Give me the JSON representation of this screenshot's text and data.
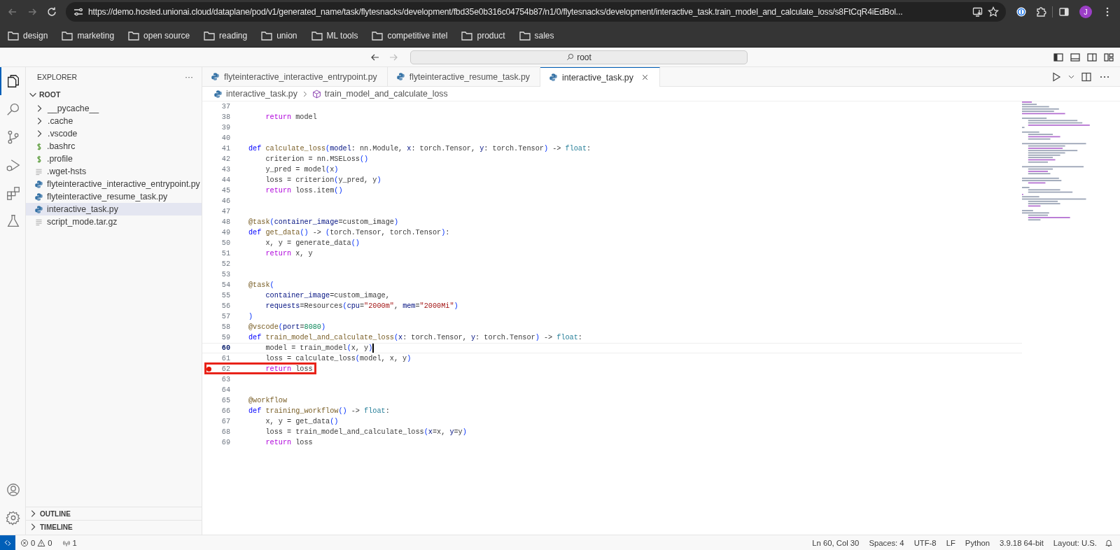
{
  "browser": {
    "url": "https://demo.hosted.unionai.cloud/dataplane/pod/v1/generated_name/task/flytesnacks/development/fbd35e0b316c04754b87/n1/0/flytesnacks/development/interactive_task.train_model_and_calculate_loss/s8FtCqR4iEdBol...",
    "profile_initial": "J",
    "bookmarks": [
      "design",
      "marketing",
      "open source",
      "reading",
      "union",
      "ML tools",
      "competitive intel",
      "product",
      "sales"
    ]
  },
  "title_bar": {
    "search": "root"
  },
  "activity_bar": [
    {
      "selected": true
    },
    {
      "selected": false
    },
    {
      "selected": false
    },
    {
      "selected": false
    },
    {
      "selected": false
    },
    {
      "selected": false
    }
  ],
  "explorer": {
    "title": "EXPLORER",
    "more": "···",
    "root": {
      "label": "ROOT",
      "expanded": true
    },
    "items": [
      {
        "label": "__pycache__",
        "kind": "folder",
        "expanded": false,
        "selected": false
      },
      {
        "label": ".cache",
        "kind": "folder",
        "expanded": false,
        "selected": false
      },
      {
        "label": ".vscode",
        "kind": "folder",
        "expanded": false,
        "selected": false
      },
      {
        "label": ".bashrc",
        "kind": "shell",
        "selected": false
      },
      {
        "label": ".profile",
        "kind": "shell",
        "selected": false
      },
      {
        "label": ".wget-hsts",
        "kind": "text",
        "selected": false
      },
      {
        "label": "flyteinteractive_interactive_entrypoint.py",
        "kind": "python",
        "selected": false
      },
      {
        "label": "flyteinteractive_resume_task.py",
        "kind": "python",
        "selected": false
      },
      {
        "label": "interactive_task.py",
        "kind": "python",
        "selected": true
      },
      {
        "label": "script_mode.tar.gz",
        "kind": "text",
        "selected": false
      }
    ],
    "sections": [
      {
        "label": "OUTLINE",
        "expanded": false
      },
      {
        "label": "TIMELINE",
        "expanded": false
      }
    ]
  },
  "tabs": [
    {
      "label": "flyteinteractive_interactive_entrypoint.py",
      "selected": false
    },
    {
      "label": "flyteinteractive_resume_task.py",
      "selected": false
    },
    {
      "label": "interactive_task.py",
      "selected": true
    }
  ],
  "breadcrumb": {
    "file": "interactive_task.py",
    "symbol": "train_model_and_calculate_loss"
  },
  "lines": [
    {
      "no": "37",
      "breakpoint": false,
      "current": false,
      "highlighted": false
    },
    {
      "no": "38",
      "breakpoint": false,
      "current": false,
      "highlighted": false,
      "tokens": [
        {
          "text": "    return",
          "kind": "control"
        },
        {
          "text": " model",
          "kind": "plain"
        }
      ]
    },
    {
      "no": "39",
      "breakpoint": false,
      "current": false,
      "highlighted": false
    },
    {
      "no": "40",
      "breakpoint": false,
      "current": false,
      "highlighted": false
    },
    {
      "no": "41",
      "breakpoint": false,
      "current": false,
      "highlighted": false,
      "tokens": [
        {
          "text": "def ",
          "kind": "keyword"
        },
        {
          "text": "calculate_loss",
          "kind": "function"
        },
        {
          "text": "(",
          "kind": "bracket"
        },
        {
          "text": "model",
          "kind": "variable"
        },
        {
          "text": ": nn.Module, ",
          "kind": "plain"
        },
        {
          "text": "x",
          "kind": "variable"
        },
        {
          "text": ": torch.Tensor, ",
          "kind": "plain"
        },
        {
          "text": "y",
          "kind": "variable"
        },
        {
          "text": ": torch.Tensor",
          "kind": "plain"
        },
        {
          "text": ")",
          "kind": "bracket"
        },
        {
          "text": " -> ",
          "kind": "plain"
        },
        {
          "text": "float",
          "kind": "type"
        },
        {
          "text": ":",
          "kind": "plain"
        }
      ]
    },
    {
      "no": "42",
      "breakpoint": false,
      "current": false,
      "highlighted": false,
      "tokens": [
        {
          "text": "    criterion = nn.MSELoss",
          "kind": "plain"
        },
        {
          "text": "()",
          "kind": "bracket"
        }
      ]
    },
    {
      "no": "43",
      "breakpoint": false,
      "current": false,
      "highlighted": false,
      "tokens": [
        {
          "text": "    y_pred = model",
          "kind": "plain"
        },
        {
          "text": "(",
          "kind": "bracket"
        },
        {
          "text": "x",
          "kind": "plain"
        },
        {
          "text": ")",
          "kind": "bracket"
        }
      ]
    },
    {
      "no": "44",
      "breakpoint": false,
      "current": false,
      "highlighted": false,
      "tokens": [
        {
          "text": "    loss = criterion",
          "kind": "plain"
        },
        {
          "text": "(",
          "kind": "bracket"
        },
        {
          "text": "y_pred, y",
          "kind": "plain"
        },
        {
          "text": ")",
          "kind": "bracket"
        }
      ]
    },
    {
      "no": "45",
      "breakpoint": false,
      "current": false,
      "highlighted": false,
      "tokens": [
        {
          "text": "    return",
          "kind": "control"
        },
        {
          "text": " loss.item",
          "kind": "plain"
        },
        {
          "text": "()",
          "kind": "bracket"
        }
      ]
    },
    {
      "no": "46",
      "breakpoint": false,
      "current": false,
      "highlighted": false
    },
    {
      "no": "47",
      "breakpoint": false,
      "current": false,
      "highlighted": false
    },
    {
      "no": "48",
      "breakpoint": false,
      "current": false,
      "highlighted": false,
      "tokens": [
        {
          "text": "@task",
          "kind": "function"
        },
        {
          "text": "(",
          "kind": "bracket"
        },
        {
          "text": "container_image",
          "kind": "variable"
        },
        {
          "text": "=custom_image",
          "kind": "plain"
        },
        {
          "text": ")",
          "kind": "bracket"
        }
      ]
    },
    {
      "no": "49",
      "breakpoint": false,
      "current": false,
      "highlighted": false,
      "tokens": [
        {
          "text": "def ",
          "kind": "keyword"
        },
        {
          "text": "get_data",
          "kind": "function"
        },
        {
          "text": "()",
          "kind": "bracket"
        },
        {
          "text": " -> ",
          "kind": "plain"
        },
        {
          "text": "(",
          "kind": "bracket"
        },
        {
          "text": "torch.Tensor, torch.Tensor",
          "kind": "plain"
        },
        {
          "text": ")",
          "kind": "bracket"
        },
        {
          "text": ":",
          "kind": "plain"
        }
      ]
    },
    {
      "no": "50",
      "breakpoint": false,
      "current": false,
      "highlighted": false,
      "tokens": [
        {
          "text": "    x, y = generate_data",
          "kind": "plain"
        },
        {
          "text": "()",
          "kind": "bracket"
        }
      ]
    },
    {
      "no": "51",
      "breakpoint": false,
      "current": false,
      "highlighted": false,
      "tokens": [
        {
          "text": "    return",
          "kind": "control"
        },
        {
          "text": " x, y",
          "kind": "plain"
        }
      ]
    },
    {
      "no": "52",
      "breakpoint": false,
      "current": false,
      "highlighted": false
    },
    {
      "no": "53",
      "breakpoint": false,
      "current": false,
      "highlighted": false
    },
    {
      "no": "54",
      "breakpoint": false,
      "current": false,
      "highlighted": false,
      "tokens": [
        {
          "text": "@task",
          "kind": "function"
        },
        {
          "text": "(",
          "kind": "bracket"
        }
      ]
    },
    {
      "no": "55",
      "breakpoint": false,
      "current": false,
      "highlighted": false,
      "tokens": [
        {
          "text": "    container_image",
          "kind": "variable"
        },
        {
          "text": "=custom_image,",
          "kind": "plain"
        }
      ]
    },
    {
      "no": "56",
      "breakpoint": false,
      "current": false,
      "highlighted": false,
      "tokens": [
        {
          "text": "    requests",
          "kind": "variable"
        },
        {
          "text": "=Resources",
          "kind": "plain"
        },
        {
          "text": "(",
          "kind": "bracket"
        },
        {
          "text": "cpu",
          "kind": "variable"
        },
        {
          "text": "=",
          "kind": "plain"
        },
        {
          "text": "\"2000m\"",
          "kind": "string"
        },
        {
          "text": ", ",
          "kind": "plain"
        },
        {
          "text": "mem",
          "kind": "variable"
        },
        {
          "text": "=",
          "kind": "plain"
        },
        {
          "text": "\"2000Mi\"",
          "kind": "string"
        },
        {
          "text": ")",
          "kind": "bracket"
        }
      ]
    },
    {
      "no": "57",
      "breakpoint": false,
      "current": false,
      "highlighted": false,
      "tokens": [
        {
          "text": ")",
          "kind": "bracket"
        }
      ]
    },
    {
      "no": "58",
      "breakpoint": false,
      "current": false,
      "highlighted": false,
      "tokens": [
        {
          "text": "@vscode",
          "kind": "function"
        },
        {
          "text": "(",
          "kind": "bracket"
        },
        {
          "text": "port",
          "kind": "variable"
        },
        {
          "text": "=",
          "kind": "plain"
        },
        {
          "text": "8080",
          "kind": "number"
        },
        {
          "text": ")",
          "kind": "bracket"
        }
      ]
    },
    {
      "no": "59",
      "breakpoint": false,
      "current": false,
      "highlighted": false,
      "tokens": [
        {
          "text": "def ",
          "kind": "keyword"
        },
        {
          "text": "train_model_and_calculate_loss",
          "kind": "function"
        },
        {
          "text": "(",
          "kind": "bracket"
        },
        {
          "text": "x",
          "kind": "variable"
        },
        {
          "text": ": torch.Tensor, ",
          "kind": "plain"
        },
        {
          "text": "y",
          "kind": "variable"
        },
        {
          "text": ": torch.Tensor",
          "kind": "plain"
        },
        {
          "text": ")",
          "kind": "bracket"
        },
        {
          "text": " -> ",
          "kind": "plain"
        },
        {
          "text": "float",
          "kind": "type"
        },
        {
          "text": ":",
          "kind": "plain"
        }
      ]
    },
    {
      "no": "60",
      "breakpoint": false,
      "current": true,
      "highlighted": false,
      "tokens": [
        {
          "text": "    model = train_model",
          "kind": "plain"
        },
        {
          "text": "(",
          "kind": "bracket"
        },
        {
          "text": "x, y",
          "kind": "plain"
        },
        {
          "text": ")",
          "kind": "bracket"
        }
      ]
    },
    {
      "no": "61",
      "breakpoint": false,
      "current": false,
      "highlighted": false,
      "tokens": [
        {
          "text": "    loss = calculate_loss",
          "kind": "plain"
        },
        {
          "text": "(",
          "kind": "bracket"
        },
        {
          "text": "model, x, y",
          "kind": "plain"
        },
        {
          "text": ")",
          "kind": "bracket"
        }
      ]
    },
    {
      "no": "62",
      "breakpoint": true,
      "current": false,
      "highlighted": true,
      "tokens": [
        {
          "text": "    return",
          "kind": "control"
        },
        {
          "text": " loss",
          "kind": "plain"
        }
      ]
    },
    {
      "no": "63",
      "breakpoint": false,
      "current": false,
      "highlighted": false
    },
    {
      "no": "64",
      "breakpoint": false,
      "current": false,
      "highlighted": false
    },
    {
      "no": "65",
      "breakpoint": false,
      "current": false,
      "highlighted": false,
      "tokens": [
        {
          "text": "@workflow",
          "kind": "function"
        }
      ]
    },
    {
      "no": "66",
      "breakpoint": false,
      "current": false,
      "highlighted": false,
      "tokens": [
        {
          "text": "def ",
          "kind": "keyword"
        },
        {
          "text": "training_workflow",
          "kind": "function"
        },
        {
          "text": "()",
          "kind": "bracket"
        },
        {
          "text": " -> ",
          "kind": "plain"
        },
        {
          "text": "float",
          "kind": "type"
        },
        {
          "text": ":",
          "kind": "plain"
        }
      ]
    },
    {
      "no": "67",
      "breakpoint": false,
      "current": false,
      "highlighted": false,
      "tokens": [
        {
          "text": "    x, y = get_data",
          "kind": "plain"
        },
        {
          "text": "()",
          "kind": "bracket"
        }
      ]
    },
    {
      "no": "68",
      "breakpoint": false,
      "current": false,
      "highlighted": false,
      "tokens": [
        {
          "text": "    loss = train_model_and_calculate_loss",
          "kind": "plain"
        },
        {
          "text": "(",
          "kind": "bracket"
        },
        {
          "text": "x",
          "kind": "variable"
        },
        {
          "text": "=x, ",
          "kind": "plain"
        },
        {
          "text": "y",
          "kind": "variable"
        },
        {
          "text": "=y",
          "kind": "plain"
        },
        {
          "text": ")",
          "kind": "bracket"
        }
      ]
    },
    {
      "no": "69",
      "breakpoint": false,
      "current": false,
      "highlighted": false,
      "tokens": [
        {
          "text": "    return",
          "kind": "control"
        },
        {
          "text": " loss",
          "kind": "plain"
        }
      ]
    }
  ],
  "status_bar": {
    "errors": "0",
    "warnings": "0",
    "ports": "1",
    "right": [
      "Ln 60, Col 30",
      "Spaces: 4",
      "UTF-8",
      "LF",
      "Python",
      "3.9.18 64-bit",
      "Layout: U.S."
    ]
  }
}
